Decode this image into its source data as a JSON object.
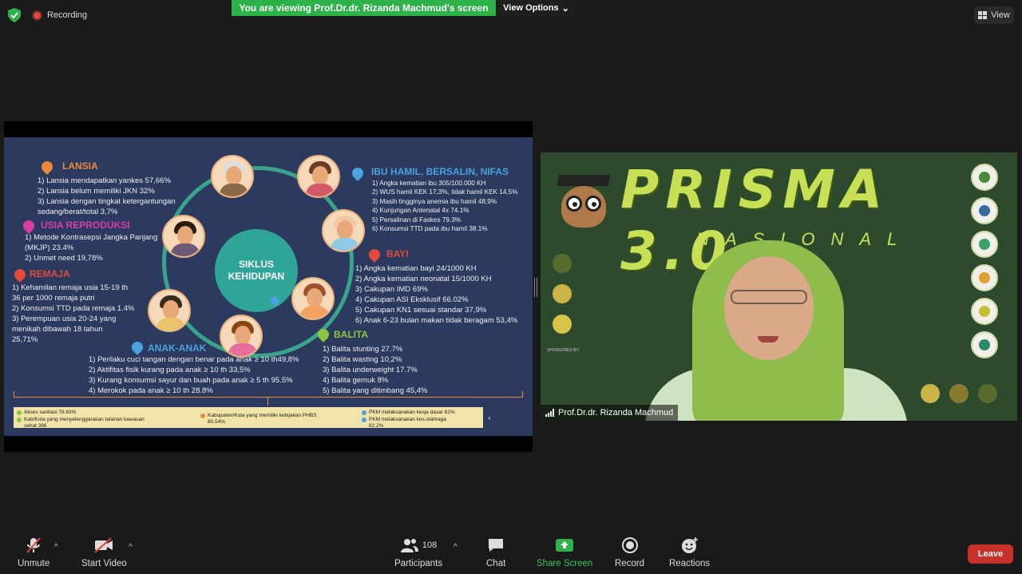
{
  "topbar": {
    "recording_label": "Recording",
    "viewing_banner": "You are viewing Prof.Dr.dr. Rizanda Machmud's screen",
    "view_options_label": "View Options",
    "view_label": "View"
  },
  "slide": {
    "center_title_line1": "SIKLUS",
    "center_title_line2": "KEHIDUPAN",
    "lansia": {
      "title": "LANSIA",
      "items": [
        "1)   Lansia mendapatkan yankes 57,66%",
        "2)   Lansia belum memiliki JKN 32%",
        "3)   Lansia dengan tingkat ketergantungan",
        "       sedang/berat/total 3,7%"
      ]
    },
    "usia_reproduksi": {
      "title": "USIA REPRODUKSI",
      "items": [
        "1)  Metode Kontrasepsi Jangka Panjang",
        "      (MKJP) 23.4%",
        "2)  Unmet need 19,78%"
      ]
    },
    "remaja": {
      "title": "REMAJA",
      "items": [
        "1)   Kehamilan remaja usia 15-19 th",
        "        36 per 1000 remaja putri",
        "2) Konsumsi TTD pada remaja 1.4%",
        "3) Perempuan     usia     20-24     yang",
        "      menikah     dibawah     18     tahun",
        "      25,71%"
      ]
    },
    "ibu_hamil": {
      "title": "IBU HAMIL, BERSALIN, NIFAS",
      "items": [
        "1)  Angka kematian ibu 305/100.000  KH",
        "2)  WUS hamil KEK 17,3%, tidak hamil KEK 14,5%",
        "3)  Masih tingginya anemia ibu hamil 48,9%",
        "4)  Kunjungan Antenatal 4x  74.1%",
        "5)  Persalinan di Faskes 79.3%",
        "6)  Konsumsi TTD pada ibu hamil  38.1%"
      ]
    },
    "bayi": {
      "title": "BAYI",
      "items": [
        "1) Angka kematian bayi 24/1000 KH",
        "2) Angka kematian neonatal 15/1000 KH",
        "3) Cakupan IMD 69%",
        "4) Cakupan ASI Eksklusif  66.02%",
        "5) Cakupan KN1 sesuai standar 37,9%",
        "6) Anak 6-23 bulan makan tidak beragam 53,4%"
      ]
    },
    "balita": {
      "title": "BALITA",
      "items": [
        "1) Balita stunting 27.7%",
        "2) Balita wasting 10,2%",
        "3) Balita underweight 17.7%",
        "4) Balita gemuk 8%",
        "5) Balita yang ditimbang 45,4%"
      ]
    },
    "anak_anak": {
      "title": "ANAK-ANAK",
      "items": [
        "1) Perilaku cuci tangan dengan benar pada anak ≥   10 th49,8%",
        "2) Aktifitas fisik kurang pada anak ≥  10 th 33,5%",
        "3) Kurang konsumsi sayur dan buah pada anak ≥  5 th 95.5%",
        "4) Merokok pada anak ≥ 10 th 28.8%"
      ]
    },
    "footer": {
      "akses_sanitasi": "Akses sanitasi 78.83%",
      "kabkota_line1": "Kab/Kota yang menyelenggarakan tatanan kawasan",
      "kabkota_line2": "sehat 366",
      "phbs_line1": "Kabupaten/Kota yang memiliki kebijakan PHBS",
      "phbs_line2": "80.54%",
      "pkm_kesja": "PKM melaksanakan kesja dasar 81%",
      "pkm_olahraga_line1": "PKM melaksanakan kes.olahraga",
      "pkm_olahraga_line2": "82.2%",
      "page_number": "4"
    }
  },
  "video": {
    "banner_title": "PRISMA 3.0",
    "banner_subtitle": "NASIONAL",
    "sponsor_label": "SPONSORED BY:",
    "participant_name": "Prof.Dr.dr. Rizanda Machmud"
  },
  "toolbar": {
    "unmute_label": "Unmute",
    "start_video_label": "Start Video",
    "participants_label": "Participants",
    "participants_count": "108",
    "chat_label": "Chat",
    "share_screen_label": "Share Screen",
    "record_label": "Record",
    "reactions_label": "Reactions",
    "leave_label": "Leave"
  },
  "colors": {
    "share_green": "#2db24a",
    "leave_red": "#c8312a",
    "slide_bg": "#2b3a5e",
    "lansia": "#e98a3a",
    "usia_reproduksi": "#d63fa0",
    "remaja": "#e24a3b",
    "ibu_hamil": "#4aa3df",
    "bayi": "#e24a3b",
    "balita": "#8cc63f",
    "anak_anak": "#4aa3df"
  }
}
